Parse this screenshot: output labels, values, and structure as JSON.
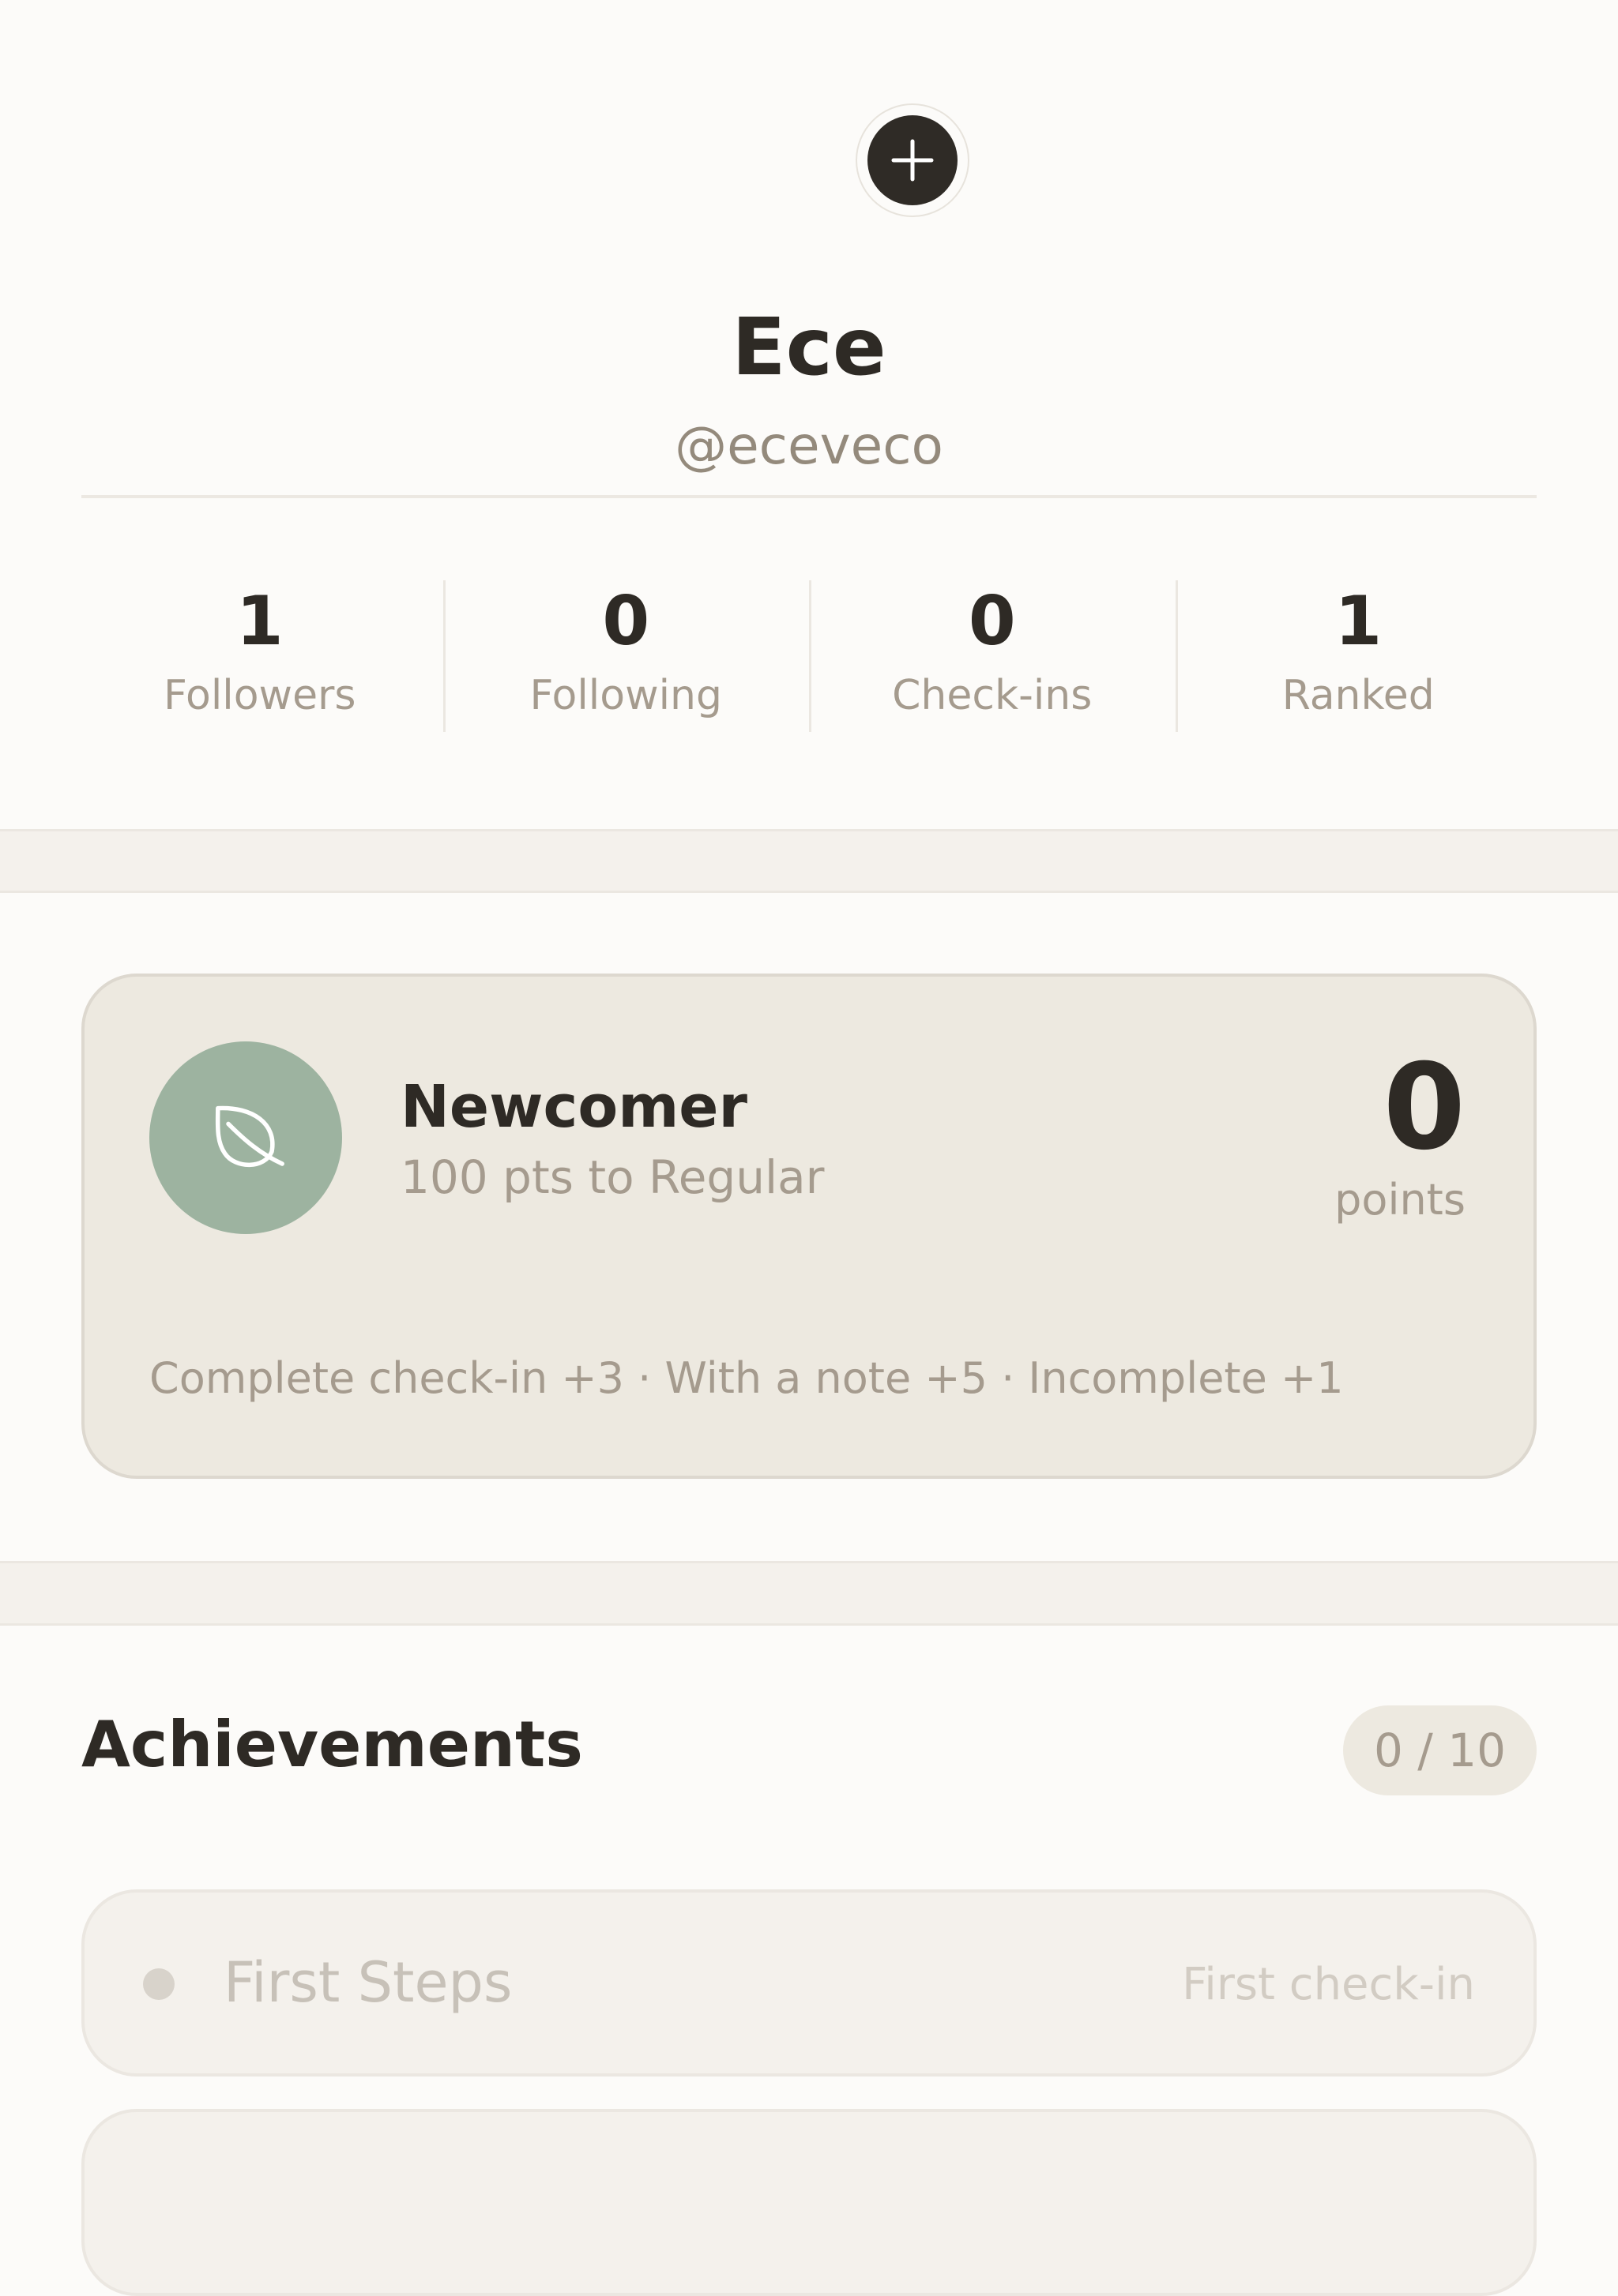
{
  "profile": {
    "add_icon": "plus-icon",
    "name": "Ece",
    "handle": "@eceveco"
  },
  "stats": [
    {
      "value": "1",
      "label": "Followers"
    },
    {
      "value": "0",
      "label": "Following"
    },
    {
      "value": "0",
      "label": "Check-ins"
    },
    {
      "value": "1",
      "label": "Ranked"
    }
  ],
  "level": {
    "icon": "leaf-icon",
    "title": "Newcomer",
    "progress": "100 pts to Regular",
    "points_value": "0",
    "points_label": "points",
    "rules": "Complete check-in +3 · With a note +5 · Incomplete +1"
  },
  "achievements": {
    "title": "Achievements",
    "count": "0 / 10",
    "items": [
      {
        "name": "First Steps",
        "description": "First check-in"
      },
      {
        "name": "",
        "description": ""
      }
    ]
  },
  "colors": {
    "background": "#fcfbf9",
    "text_primary": "#2e2a25",
    "text_secondary": "#a59b8e",
    "card": "#ede9e0",
    "badge_green": "#9db3a0"
  }
}
